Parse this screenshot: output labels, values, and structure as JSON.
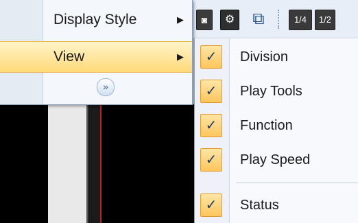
{
  "menu": {
    "items": [
      {
        "label": "Display Style",
        "arrow": "▶"
      },
      {
        "label": "View",
        "arrow": "▶"
      }
    ],
    "expand_icon": "»"
  },
  "toolbar": {
    "camera_icon": "camera-icon",
    "settings_icon": "settings-icon",
    "layout_icon": "layout-icon",
    "quarter_label": "1/4",
    "half_label": "1/2"
  },
  "submenu": {
    "items": [
      {
        "label": "Division",
        "checked": true,
        "check": "✓"
      },
      {
        "label": "Play Tools",
        "checked": true,
        "check": "✓"
      },
      {
        "label": "Function",
        "checked": true,
        "check": "✓"
      },
      {
        "label": "Play Speed",
        "checked": true,
        "check": "✓"
      },
      {
        "label": "Status",
        "checked": true,
        "check": "✓"
      }
    ]
  },
  "colors": {
    "highlight": "#ffd97a",
    "check_bg": "#ffc65c",
    "menu_bg": "#f4f7fb"
  }
}
